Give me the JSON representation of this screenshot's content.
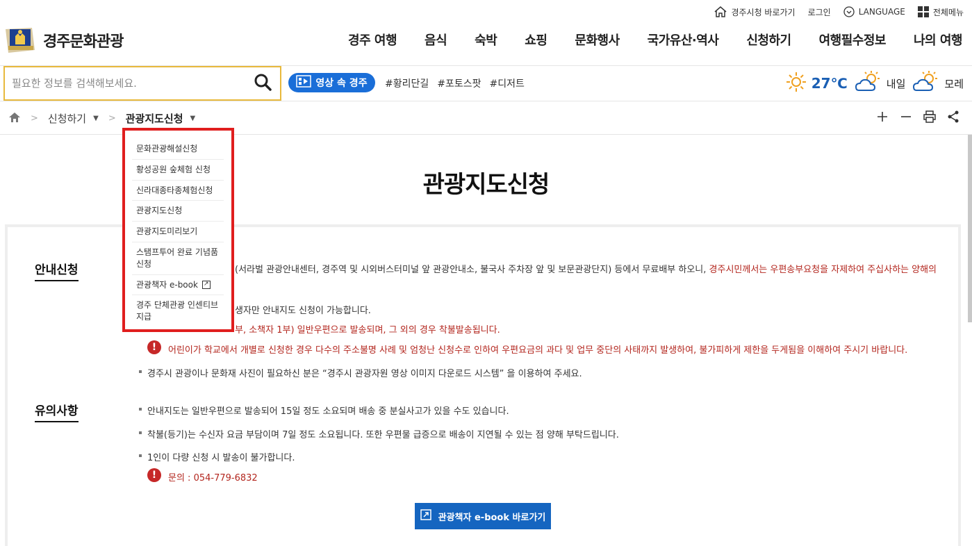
{
  "util": {
    "city_hall": "경주시청 바로가기",
    "login": "로그인",
    "language": "LANGUAGE",
    "all_menu": "전체메뉴"
  },
  "logo": {
    "title": "경주문화관광"
  },
  "gnb": [
    "경주 여행",
    "음식",
    "숙박",
    "쇼핑",
    "문화행사",
    "국가유산·역사",
    "신청하기",
    "여행필수정보",
    "나의 여행"
  ],
  "search": {
    "placeholder": "필요한 정보를 검색해보세요."
  },
  "video_button": "영상 속 경주",
  "tags": [
    "#황리단길",
    "#포토스팟",
    "#디저트"
  ],
  "weather": {
    "today": "27℃",
    "tomorrow": "내일",
    "day_after": "모레"
  },
  "breadcrumb": {
    "level1": "신청하기",
    "level2": "관광지도신청"
  },
  "dropdown": [
    "문화관광해설신청",
    "황성공원 숲체험 신청",
    "신라대종타종체험신청",
    "관광지도신청",
    "관광지도미리보기",
    "스탬프투어 완료 기념품 신청",
    "관광책자 e-book",
    "경주 단체관광 인센티브 지급"
  ],
  "page_title": "관광지도신청",
  "section1": {
    "title": "안내신청",
    "line1": "(서라벌 관광안내센터, 경주역 및 시외버스터미널 앞 관광안내소, 불국사 주차장 앞 및 보문관광단지) 등에서 무료배부 하오니, ",
    "line1_red": "경주시민께서는 우편송부요청을 자제하여 주십사하는 양해의",
    "line2": "생자만 안내지도 신청이 가능합니다.",
    "line3": "부, 소책자 1부) 일반우편으로 발송되며, 그 외의 경우 착불발송됩니다.",
    "line4": "어린이가 학교에서 개별로 신청한 경우 다수의 주소불명 사례 및 엄청난 신청수로 인하여 우편요금의 과다 및 업무 중단의 사태까지 발생하여, 불가피하게 제한을 두게됨을 이해하여 주시기 바랍니다.",
    "line5": "경주시 관광이나 문화재 사진이 필요하신 분은 “경주시 관광자원 영상 이미지 다운로드 시스템” 을 이용하여 주세요."
  },
  "section2": {
    "title": "유의사항",
    "line1": "안내지도는 일반우편으로 발송되어 15일 정도 소요되며 배송 중 분실사고가 있을 수도 있습니다.",
    "line2": "착불(등기)는 수신자 요금 부담이며 7일 정도 소요됩니다. 또한 우편물 급증으로 배송이 지연될 수 있는 점 양해 부탁드립니다.",
    "line3": "1인이 다량 신청 시 발송이 불가합니다.",
    "contact": "문의 : 054-779-6832"
  },
  "ebook_button": "관광책자 e-book 바로가기"
}
